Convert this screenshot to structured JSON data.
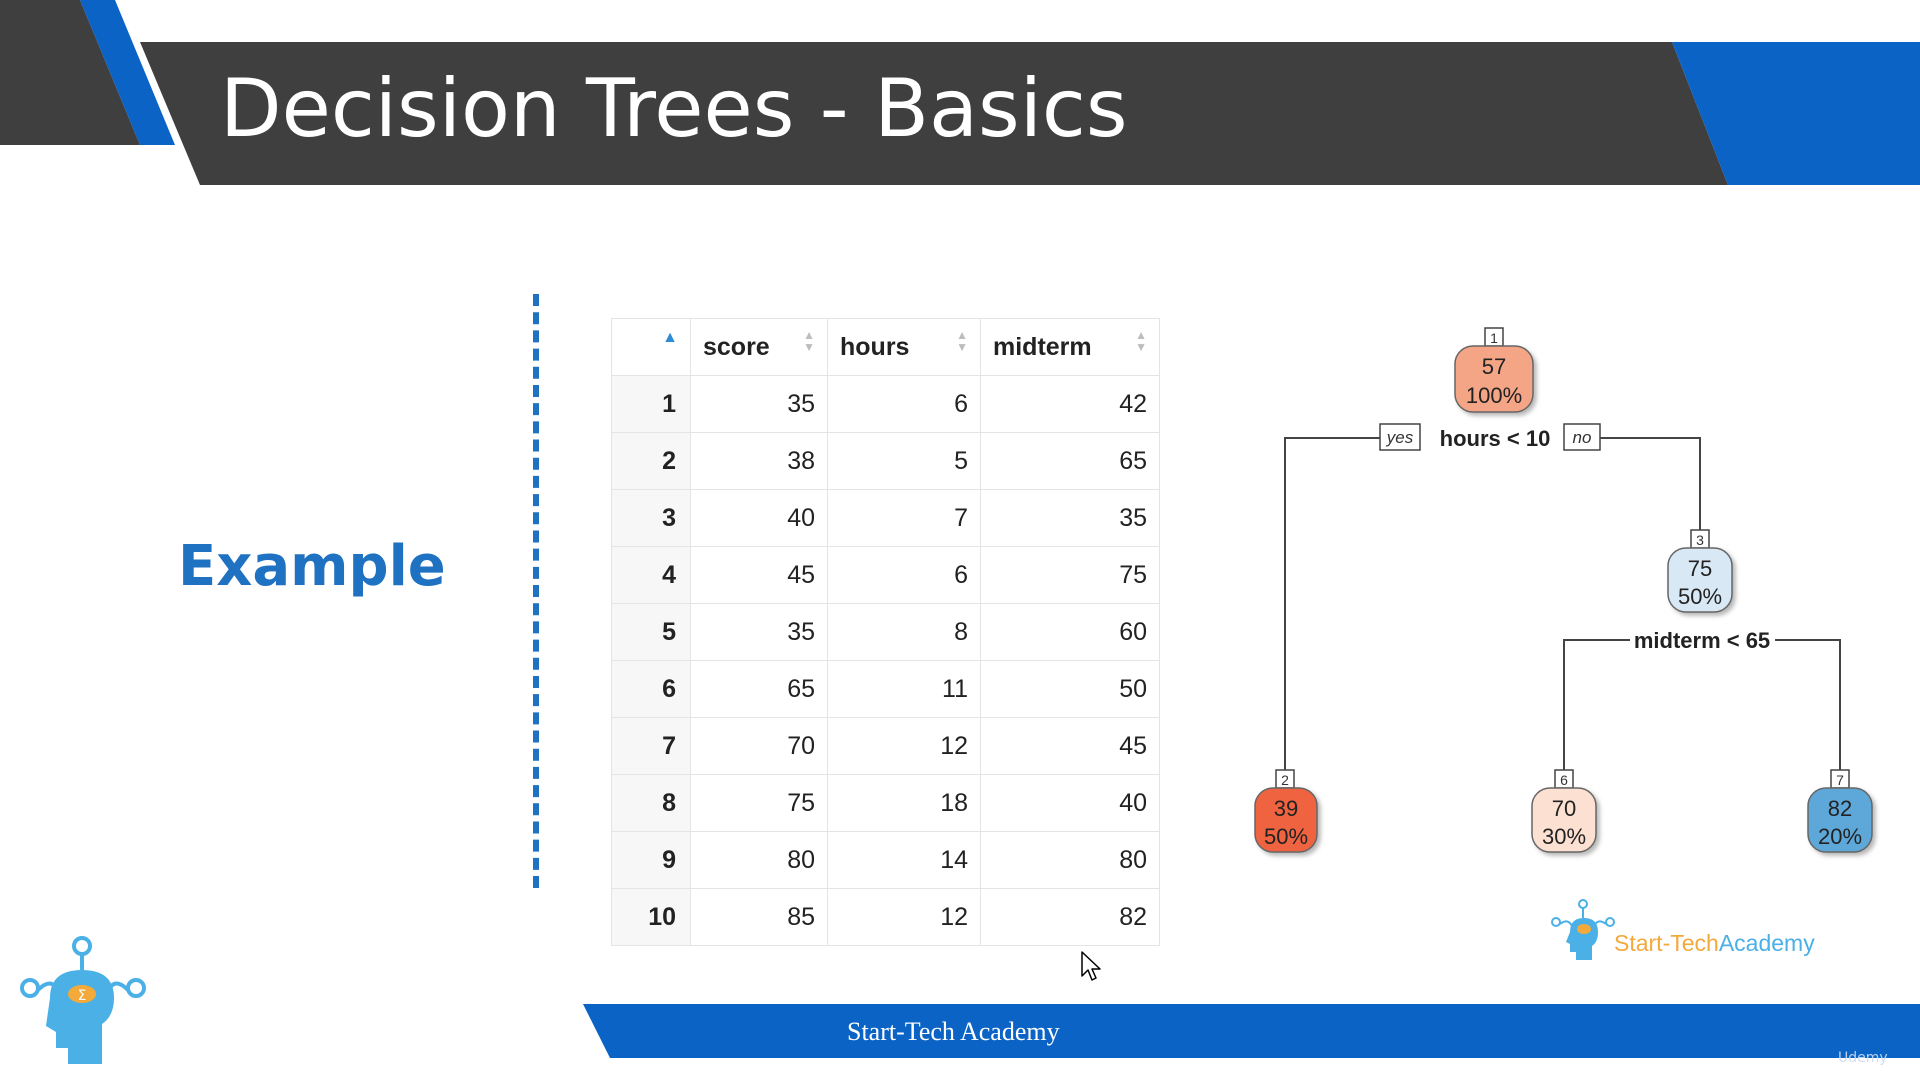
{
  "slide": {
    "title": "Decision Trees - Basics",
    "example_label": "Example",
    "footer_text": "Start-Tech Academy",
    "logo_text_left": "Start-Tech",
    "logo_text_right": "Academy",
    "watermark": "Udemy",
    "colors": {
      "dark_band": "#3f3f3f",
      "accent_blue": "#0b63c5",
      "example_blue": "#1f71c1"
    }
  },
  "table": {
    "columns": [
      "score",
      "hours",
      "midterm"
    ],
    "rows": [
      {
        "index": "1",
        "score": "35",
        "hours": "6",
        "midterm": "42"
      },
      {
        "index": "2",
        "score": "38",
        "hours": "5",
        "midterm": "65"
      },
      {
        "index": "3",
        "score": "40",
        "hours": "7",
        "midterm": "35"
      },
      {
        "index": "4",
        "score": "45",
        "hours": "6",
        "midterm": "75"
      },
      {
        "index": "5",
        "score": "35",
        "hours": "8",
        "midterm": "60"
      },
      {
        "index": "6",
        "score": "65",
        "hours": "11",
        "midterm": "50"
      },
      {
        "index": "7",
        "score": "70",
        "hours": "12",
        "midterm": "45"
      },
      {
        "index": "8",
        "score": "75",
        "hours": "18",
        "midterm": "40"
      },
      {
        "index": "9",
        "score": "80",
        "hours": "14",
        "midterm": "80"
      },
      {
        "index": "10",
        "score": "85",
        "hours": "12",
        "midterm": "82"
      }
    ]
  },
  "tree": {
    "nodes": [
      {
        "id": "1",
        "value": "57",
        "percent": "100%",
        "color": "#f4a585"
      },
      {
        "id": "2",
        "value": "39",
        "percent": "50%",
        "color": "#ef6441"
      },
      {
        "id": "3",
        "value": "75",
        "percent": "50%",
        "color": "#d9e8f5"
      },
      {
        "id": "6",
        "value": "70",
        "percent": "30%",
        "color": "#fce0d2"
      },
      {
        "id": "7",
        "value": "82",
        "percent": "20%",
        "color": "#5da8d8"
      }
    ],
    "splits": [
      {
        "label": "hours < 10",
        "yes": "yes",
        "no": "no"
      },
      {
        "label": "midterm < 65"
      }
    ]
  }
}
